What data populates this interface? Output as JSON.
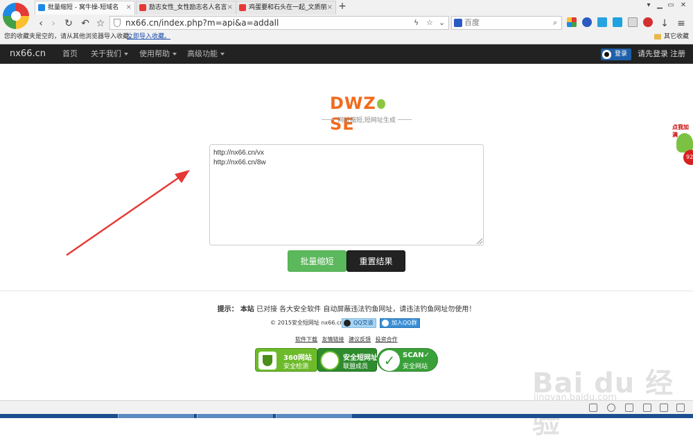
{
  "browser": {
    "tabs": [
      {
        "label": "批量缩短 - 窝牛操-短域名",
        "active": true,
        "favicon_color": "#1e88e5"
      },
      {
        "label": "励志女性_女性励志名人名言",
        "active": false,
        "favicon_color": "#e53935"
      },
      {
        "label": "鸡蛋要和石头在一起_文质丽",
        "active": false,
        "favicon_color": "#e53935"
      }
    ],
    "close_glyph": "×",
    "new_tab_glyph": "+",
    "address": "nx66.cn/index.php?m=api&a=addall",
    "search_placeholder": "百度",
    "bookmarks": {
      "notice": "您的收藏夹是空的，请从其他浏览器导入收藏。",
      "import_link": "立即导入收藏。",
      "other_folder": "其它收藏"
    }
  },
  "site_nav": {
    "brand": "nx66.cn",
    "home": "首页",
    "about": "关于我们",
    "help": "使用帮助",
    "advanced": "高级功能",
    "login_button": "登录",
    "login_first": "请先登录",
    "register": "注册"
  },
  "logo": {
    "text_left": "DWZ",
    "text_right": "SE",
    "slogan": "网址缩短,短网址生成"
  },
  "form": {
    "urls": "http://nx66.cn/vx\nhttp://nx66.cn/8w",
    "shorten_button": "批量缩短",
    "reset_button": "重置结果"
  },
  "footer": {
    "tip_label": "提示：",
    "tip_site": "本站",
    "tip_text": "已对接 各大安全软件 自动屏蔽违法钓鱼网址，请违法钓鱼网址勿使用！",
    "copyright": "© 2015安全短网址 nx66.cn",
    "qq_chat": "QQ交谈",
    "qq_group": "加入QQ群",
    "links": [
      "软件下载",
      "友情链接",
      "建议反馈",
      "投资合作"
    ],
    "badges": {
      "b360_line1": "360网站",
      "b360_line2": "安全检测",
      "alliance_line1": "安全短网址",
      "alliance_line2": "联盟成员",
      "scan_line1": "SCAN✓",
      "scan_line2": "安全网站"
    }
  },
  "float_widget": {
    "label": "点我加满",
    "counter": "92"
  },
  "watermark": {
    "logo": "Bai du 经验",
    "url": "jingyan.baidu.com"
  },
  "colors": {
    "accent_green": "#5cb85c",
    "nav_dark": "#222222",
    "logo_orange": "#f26b1d",
    "annotation_arrow": "#e53935"
  }
}
